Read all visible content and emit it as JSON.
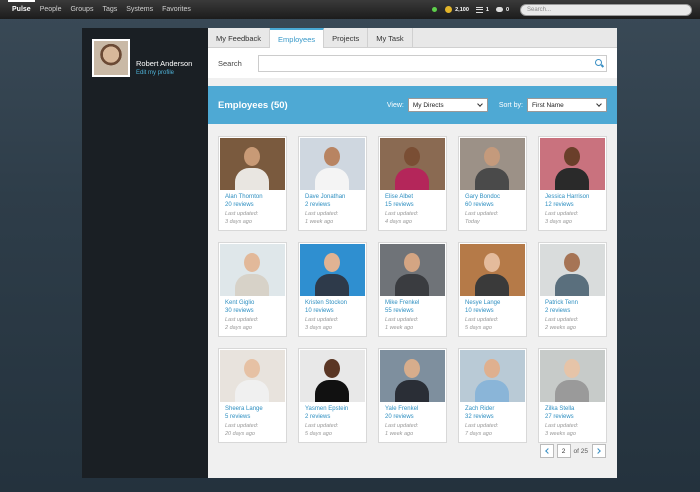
{
  "topbar": {
    "nav": [
      "Pulse",
      "People",
      "Groups",
      "Tags",
      "Systems",
      "Favorites"
    ],
    "coins": "2,100",
    "list_count": "1",
    "chat_count": "0",
    "search_placeholder": "Search..."
  },
  "profile": {
    "name": "Robert Anderson",
    "edit_link": "Edit my profile"
  },
  "tabs": [
    "My Feedback",
    "Employees",
    "Projects",
    "My Task"
  ],
  "search": {
    "label": "Search",
    "value": ""
  },
  "employees_bar": {
    "title": "Employees (50)",
    "view_label": "View:",
    "view_value": "My Directs",
    "sort_label": "Sort by:",
    "sort_value": "First Name"
  },
  "employees": [
    {
      "name": "Alan Thornton",
      "reviews": "20 reviews",
      "updated_label": "Last updated:",
      "updated": "3 days ago",
      "bg": "#7a5a3e",
      "skin": "#c89a76",
      "shirt": "#e9e6e1"
    },
    {
      "name": "Dave Jonathan",
      "reviews": "2 reviews",
      "updated_label": "Last updated:",
      "updated": "1 week ago",
      "bg": "#cfd7e0",
      "skin": "#b88462",
      "shirt": "#f4f4f4"
    },
    {
      "name": "Elise Albet",
      "reviews": "15 reviews",
      "updated_label": "Last updated:",
      "updated": "4 days ago",
      "bg": "#8a6a52",
      "skin": "#7a4e34",
      "shirt": "#b4265a"
    },
    {
      "name": "Gary Bondoc",
      "reviews": "60 reviews",
      "updated_label": "Last updated:",
      "updated": "Today",
      "bg": "#9c9187",
      "skin": "#c49a7c",
      "shirt": "#4a4a4a"
    },
    {
      "name": "Jessica Harrison",
      "reviews": "12 reviews",
      "updated_label": "Last updated:",
      "updated": "3 days ago",
      "bg": "#c9727e",
      "skin": "#6a3f2a",
      "shirt": "#2a2a2a"
    },
    {
      "name": "Kent Giglio",
      "reviews": "30 reviews",
      "updated_label": "Last updated:",
      "updated": "2 days ago",
      "bg": "#dfe7ea",
      "skin": "#e2b99a",
      "shirt": "#d7d2c8"
    },
    {
      "name": "Kristen Stockon",
      "reviews": "10 reviews",
      "updated_label": "Last updated:",
      "updated": "3 days ago",
      "bg": "#2f8fd0",
      "skin": "#e0b393",
      "shirt": "#2e3a4a"
    },
    {
      "name": "Mike Frenkel",
      "reviews": "55 reviews",
      "updated_label": "Last updated:",
      "updated": "1 week ago",
      "bg": "#6f7378",
      "skin": "#d4a583",
      "shirt": "#3a3c40"
    },
    {
      "name": "Nesye Lange",
      "reviews": "10 reviews",
      "updated_label": "Last updated:",
      "updated": "5 days ago",
      "bg": "#b57a48",
      "skin": "#e4bb9c",
      "shirt": "#3a3a3a"
    },
    {
      "name": "Patrick Tenn",
      "reviews": "2 reviews",
      "updated_label": "Last updated:",
      "updated": "2 weeks ago",
      "bg": "#d9dcdc",
      "skin": "#a67455",
      "shirt": "#5a6f7d"
    },
    {
      "name": "Sheera Lange",
      "reviews": "5 reviews",
      "updated_label": "Last updated:",
      "updated": "20 days ago",
      "bg": "#e8e3dd",
      "skin": "#e6c1a4",
      "shirt": "#f0f0f0"
    },
    {
      "name": "Yasmen Epstein",
      "reviews": "2 reviews",
      "updated_label": "Last updated:",
      "updated": "5 days ago",
      "bg": "#e8e8e8",
      "skin": "#5a3624",
      "shirt": "#111111"
    },
    {
      "name": "Yale Frenkel",
      "reviews": "20 reviews",
      "updated_label": "Last updated:",
      "updated": "1 week ago",
      "bg": "#7e8f9e",
      "skin": "#d7ad8c",
      "shirt": "#2a2e36"
    },
    {
      "name": "Zach Rider",
      "reviews": "32 reviews",
      "updated_label": "Last updated:",
      "updated": "7 days ago",
      "bg": "#b9cad6",
      "skin": "#dfb08f",
      "shirt": "#8ab5d8"
    },
    {
      "name": "Zilka Stella",
      "reviews": "27 reviews",
      "updated_label": "Last updated:",
      "updated": "3 weeks ago",
      "bg": "#c7cbc9",
      "skin": "#e6c4a8",
      "shirt": "#9a9a9a"
    }
  ],
  "pagination": {
    "current": "2",
    "total": "of 25"
  }
}
